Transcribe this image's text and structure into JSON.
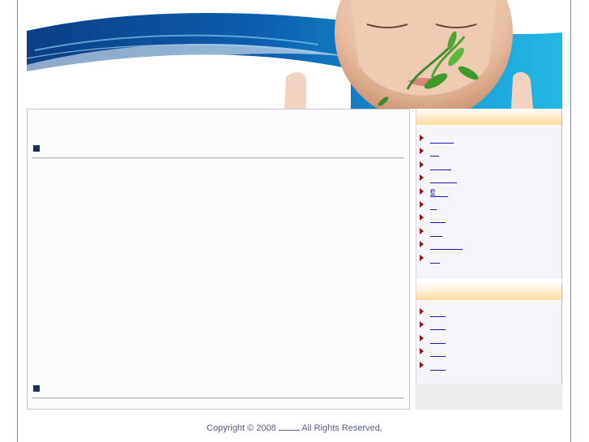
{
  "main": {
    "section_1_title": "",
    "section_2_title": ""
  },
  "sidebar": {
    "box1_heading": "",
    "box1_items": [
      {
        "label": ""
      },
      {
        "label": ""
      },
      {
        "label": ""
      },
      {
        "label": ""
      },
      {
        "label": "e"
      },
      {
        "label": ""
      },
      {
        "label": ""
      },
      {
        "label": ""
      },
      {
        "label": ""
      },
      {
        "label": ""
      }
    ],
    "box2_heading": "",
    "box2_items": [
      {
        "label": ""
      },
      {
        "label": ""
      },
      {
        "label": ""
      },
      {
        "label": ""
      },
      {
        "label": ""
      }
    ]
  },
  "footer": {
    "copyright_prefix": "Copyright © 2008",
    "copyright_suffix": "All Rights Reserved."
  },
  "colors": {
    "accent_navy": "#1f2e5c",
    "link_blue": "#1a1ab0",
    "arrow_red": "#8b1a1a",
    "banner_blue": "#0b5aa8"
  }
}
